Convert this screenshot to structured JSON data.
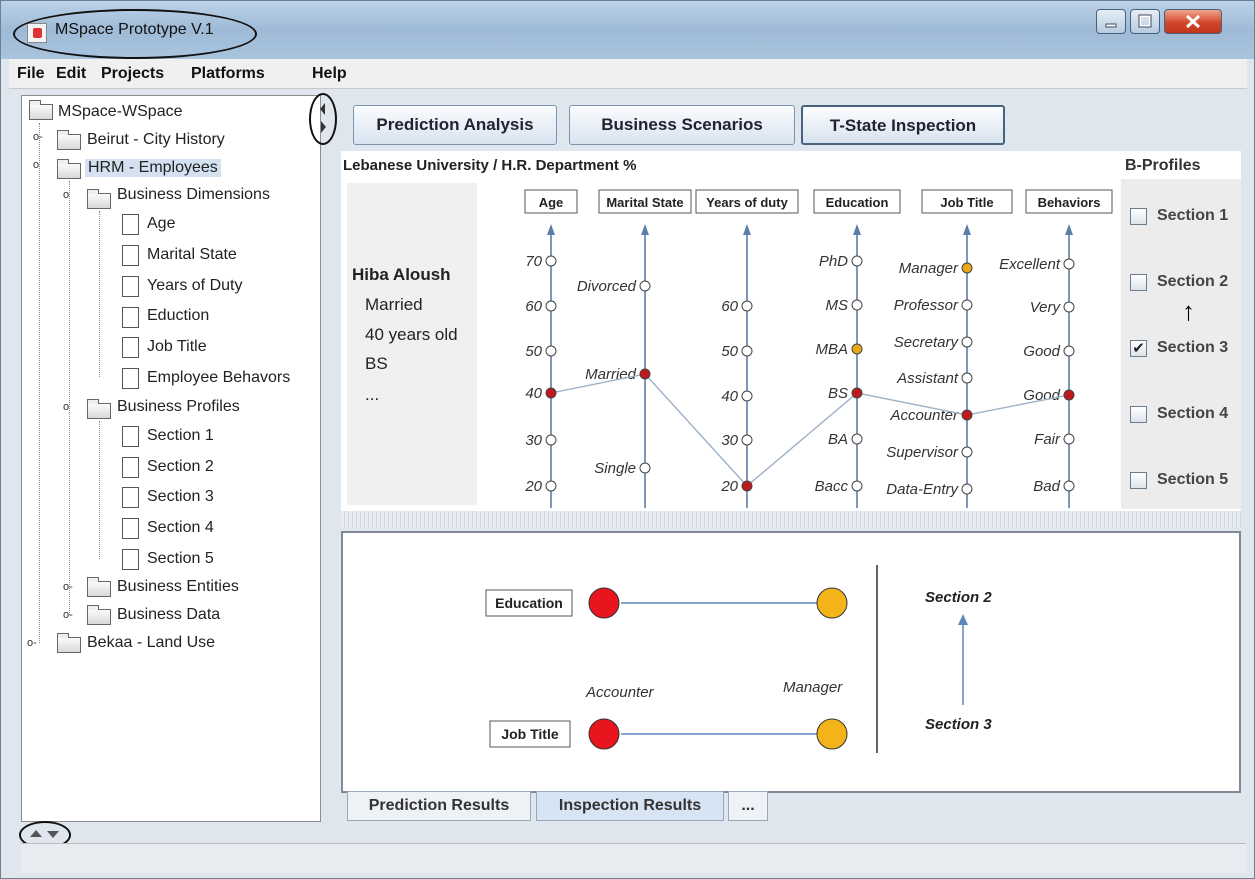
{
  "window": {
    "title": "MSpace Prototype V.1"
  },
  "menu": [
    "File",
    "Edit",
    "Projects",
    "Platforms",
    "Help"
  ],
  "tree": {
    "root": "MSpace-WSpace",
    "project1": "Beirut - City History",
    "project2": "HRM - Employees",
    "dimensions": "Business Dimensions",
    "dimension_items": [
      "Age",
      "Marital State",
      "Years of Duty",
      "Eduction",
      "Job Title",
      "Employee Behavors"
    ],
    "profiles": "Business Profiles",
    "profile_items": [
      "Section 1",
      "Section 2",
      "Section 3",
      "Section 4",
      "Section 5"
    ],
    "entities": "Business Entities",
    "data": "Business Data",
    "project3": "Bekaa - Land Use"
  },
  "tabs": [
    "Prediction Analysis",
    "Business Scenarios",
    "T-State Inspection"
  ],
  "header": {
    "department": "Lebanese University / H.R. Department %",
    "bprofiles": "B-Profiles"
  },
  "person": {
    "name": "Hiba Aloush",
    "marital": "Married",
    "age": "40 years old",
    "education": "BS",
    "more": "..."
  },
  "sections": [
    {
      "label": "Section 1",
      "checked": false
    },
    {
      "label": "Section 2",
      "checked": false
    },
    {
      "label": "Section 3",
      "checked": true
    },
    {
      "label": "Section 4",
      "checked": false
    },
    {
      "label": "Section 5",
      "checked": false
    }
  ],
  "checkmark": "✔",
  "chart_data": {
    "type": "parallel-coordinates",
    "axes": [
      {
        "name": "Age",
        "ticks": [
          "70",
          "60",
          "50",
          "40",
          "30",
          "20"
        ],
        "value": "40"
      },
      {
        "name": "Marital State",
        "ticks": [
          "Divorced",
          "Married",
          "Single"
        ],
        "value": "Married"
      },
      {
        "name": "Years of duty",
        "ticks": [
          "60",
          "50",
          "40",
          "30",
          "20"
        ],
        "value": "20"
      },
      {
        "name": "Education",
        "ticks": [
          "PhD",
          "MS",
          "MBA",
          "BS",
          "BA",
          "Bacc"
        ],
        "value": "BS",
        "target": "MBA"
      },
      {
        "name": "Job Title",
        "ticks": [
          "Manager",
          "Professor",
          "Secretary",
          "Assistant",
          "Accounter",
          "Supervisor",
          "Data-Entry"
        ],
        "value": "Accounter",
        "target": "Manager"
      },
      {
        "name": "Behaviors",
        "ticks": [
          "Excellent",
          "Very",
          "Good",
          "Good",
          "Fair",
          "Bad"
        ],
        "value": "Good"
      }
    ],
    "colors": {
      "selected": "#c0191d",
      "target": "#e8a817",
      "line": "#9fb1c8"
    }
  },
  "results": {
    "rows": [
      {
        "label": "Education",
        "from": "",
        "to": ""
      },
      {
        "label": "Job Title",
        "from": "Accounter",
        "to": "Manager"
      }
    ],
    "section_to": "Section 2",
    "section_from": "Section 3",
    "colors": {
      "from": "#e8141e",
      "to": "#f5b31a"
    }
  },
  "bottom_tabs": [
    "Prediction Results",
    "Inspection Results",
    "..."
  ]
}
